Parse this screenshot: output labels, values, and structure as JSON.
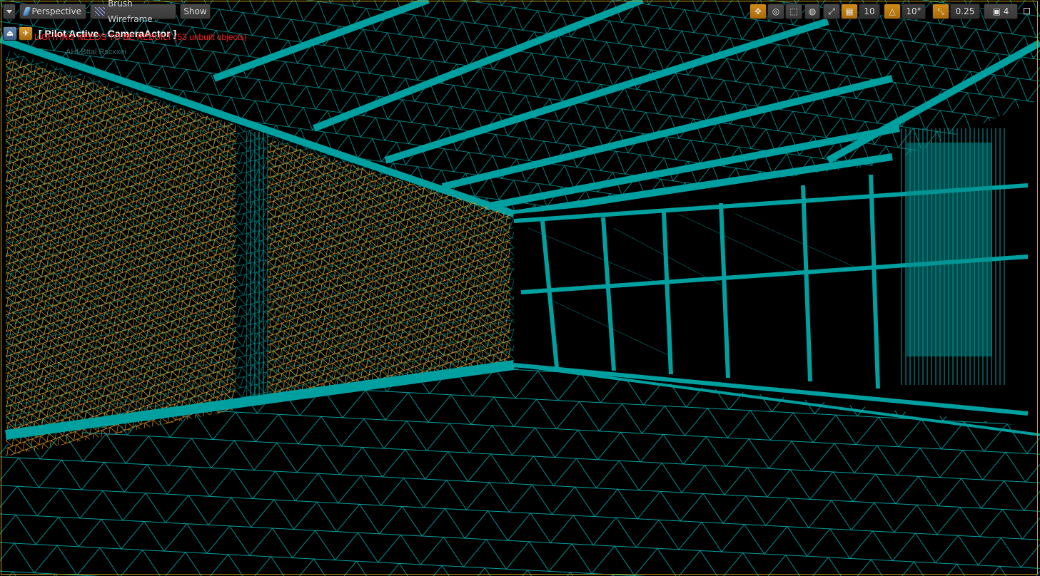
{
  "toolbar": {
    "perspective_label": "Perspective",
    "view_mode_label": "Brush Wireframe",
    "show_label": "Show"
  },
  "right_toolbar": {
    "grid_snap_value": "10",
    "rotation_snap_value": "10°",
    "scale_snap_value": "0.25",
    "camera_speed_value": "4"
  },
  "pilot": {
    "label": "[ Pilot Active - CameraActor ]"
  },
  "status": {
    "lighting_message": "LIGHTING NEEDS TO BE REBUILT (53 unbuilt objects)",
    "ghost_text": "AHI Bttal Rscxxei"
  },
  "colors": {
    "wire_cyan": "#00a0a0",
    "wire_orange": "#f0a020",
    "active_accent": "#c8a020",
    "error_red": "#ff2020"
  }
}
